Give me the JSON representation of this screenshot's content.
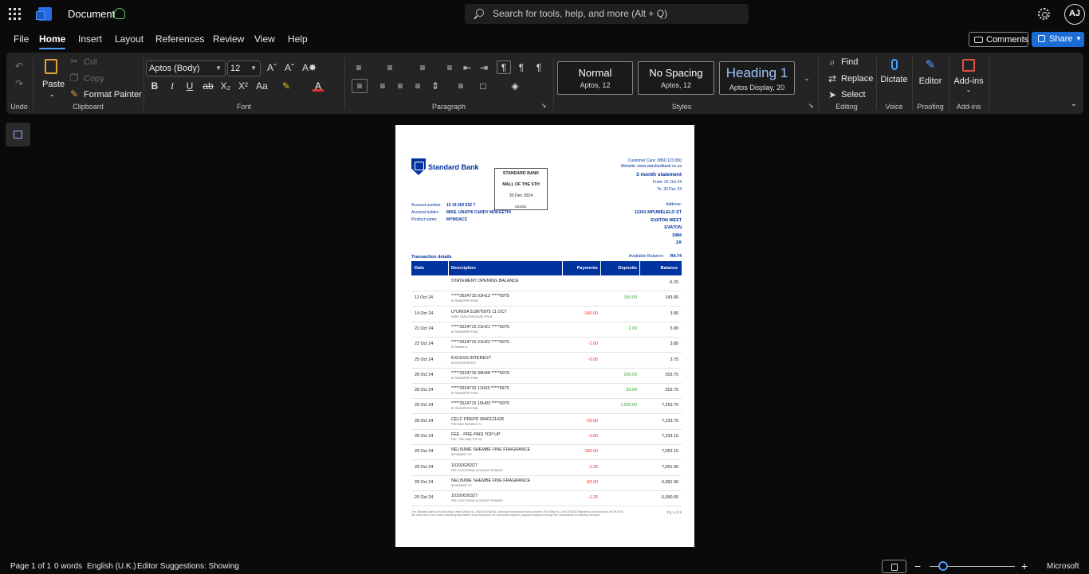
{
  "app": {
    "title": "Document",
    "search_placeholder": "Search for tools, help, and more (Alt + Q)",
    "user_initials": "AJ"
  },
  "menu": [
    "File",
    "Home",
    "Insert",
    "Layout",
    "References",
    "Review",
    "View",
    "Help"
  ],
  "actions": {
    "comments": "Comments",
    "share": "Share"
  },
  "ribbon": {
    "undo_label": "Undo",
    "clipboard": {
      "paste": "Paste",
      "cut": "Cut",
      "copy": "Copy",
      "format_painter": "Format Painter",
      "label": "Clipboard"
    },
    "font": {
      "name": "Aptos (Body)",
      "size": "12",
      "label": "Font"
    },
    "paragraph": {
      "label": "Paragraph"
    },
    "styles": {
      "items": [
        {
          "name": "Normal",
          "sub": "Aptos, 12"
        },
        {
          "name": "No Spacing",
          "sub": "Aptos, 12"
        },
        {
          "name": "Heading 1",
          "sub": "Aptos Display, 20"
        }
      ],
      "label": "Styles"
    },
    "editing": {
      "find": "Find",
      "replace": "Replace",
      "select": "Select",
      "label": "Editing"
    },
    "voice": {
      "dictate": "Dictate",
      "label": "Voice"
    },
    "proofing": {
      "editor": "Editor",
      "label": "Proofing"
    },
    "addins": {
      "addins": "Add-ins",
      "label": "Add-ins"
    }
  },
  "statement": {
    "bank_name": "Standard Bank",
    "stamp": [
      "STANDARD BANK",
      "MALL OF THE STH",
      "30 Dec 2024",
      "051001"
    ],
    "customer_care": "Customer Care: 0860 123 000",
    "website": "Website: www.standardbank.co.za",
    "title": "3 month statement",
    "from": "From: 01 Oct 24",
    "to": "To: 30 Dec 24",
    "account_number_label": "Account number:",
    "account_number": "10 19 262 632 7",
    "account_holder_label": "Account holder:",
    "account_holder": "MISS. UNATHI CANDY MOKGETHI",
    "product_label": "Product name:",
    "product": "MYMOACC",
    "address_label": "Address:",
    "address": [
      "11341 MPUMELELO ST",
      "EVATON WEST",
      "EVATON",
      "1984",
      "ZA"
    ],
    "transaction_details": "Transaction details",
    "available_balance_label": "Available Balance:",
    "available_balance": "R4.74",
    "columns": [
      "Date",
      "Description",
      "Payments",
      "Deposits",
      "Balance"
    ],
    "rows": [
      {
        "date": "",
        "desc": "STATEMENT OPENING BALANCE",
        "sub": "",
        "payment": "",
        "deposit": "",
        "balance": "-6.20"
      },
      {
        "date": "11 Oct 24",
        "desc": "*****2624715 02H12 *****6975",
        "sub": "IB TRANSFER FROM",
        "payment": "",
        "deposit": "150.00",
        "balance": "143.80"
      },
      {
        "date": "14 Oct 24",
        "desc": "U*UNISA 5196*6975 11 OCT",
        "sub": "DEBIT CARD PURCHASE FROM",
        "payment": "-140.00",
        "deposit": "",
        "balance": "3.80"
      },
      {
        "date": "22 Oct 24",
        "desc": "*****2624715 21H21 *****6975",
        "sub": "IB TRANSFER FROM",
        "payment": "",
        "deposit": "2.00",
        "balance": "5.80"
      },
      {
        "date": "22 Oct 24",
        "desc": "*****2624715 21H22 *****6975",
        "sub": "IB Transfer to",
        "payment": "-2.00",
        "deposit": "",
        "balance": "3.80"
      },
      {
        "date": "25 Oct 24",
        "desc": "EXCESS INTEREST",
        "sub": "EXCESS INTEREST",
        "payment": "-0.05",
        "deposit": "",
        "balance": "3.75"
      },
      {
        "date": "28 Oct 24",
        "desc": "*****2624715 09H48 *****6975",
        "sub": "IB TRANSFER FROM",
        "payment": "",
        "deposit": "200.00",
        "balance": "203.75"
      },
      {
        "date": "28 Oct 24",
        "desc": "*****2624715 11H33 *****6975",
        "sub": "IB TRANSFER FROM",
        "payment": "",
        "deposit": "50.00",
        "balance": "253.75"
      },
      {
        "date": "28 Oct 24",
        "desc": "*****2624715 15H03 *****6975",
        "sub": "IB TRANSFER FROM",
        "payment": "",
        "deposit": "7,000.00",
        "balance": "7,253.75"
      },
      {
        "date": "28 Oct 24",
        "desc": "CELC PREPD 0840121428",
        "sub": "PRE-PAID PAYMENT TO",
        "payment": "-20.00",
        "deposit": "",
        "balance": "7,233.75"
      },
      {
        "date": "28 Oct 24",
        "desc": "FEE - PRE-PAID TOP UP",
        "sub": "FEE - PRE-PAID TOP UP",
        "payment": "-0.60",
        "deposit": "",
        "balance": "7,233.15"
      },
      {
        "date": "29 Oct 24",
        "desc": "NELISIWE SHEMBE FINE FRAGRANCE",
        "sub": "IB PAYMENT TO",
        "payment": "-180.00",
        "deposit": "",
        "balance": "7,053.15"
      },
      {
        "date": "29 Oct 24",
        "desc": "10192626327",
        "sub": "FEE: ELECTRONIC ACCOUNT PAYMENT",
        "payment": "-1.25",
        "deposit": "",
        "balance": "7,051.90"
      },
      {
        "date": "29 Oct 24",
        "desc": "NELISIWE SHEMBE FINE FRAGRANCE",
        "sub": "IB PAYMENT TO",
        "payment": "-60.00",
        "deposit": "",
        "balance": "6,991.90"
      },
      {
        "date": "29 Oct 24",
        "desc": "10192626327",
        "sub": "FEE: ELECTRONIC ACCOUNT PAYMENT",
        "payment": "-1.25",
        "deposit": "",
        "balance": "6,990.65"
      }
    ],
    "footer_line1": "The Standard Bank of South Africa Limited (Reg. No. 1962/000738/06). Authorised financial services provider. FAIS Reg No. 2/06/70/2020 Registered credit provider (NCRCP15).",
    "footer_line2": "We subscribe to the Code of Banking Association South Africa and, for unresolved disputes, support resolution through the Ombudsman for Banking Services.",
    "page_num": "Pg 1 of 8"
  },
  "status": {
    "page": "Page 1 of 1",
    "words": "0 words",
    "language": "English (U.K.)",
    "suggestions": "Editor Suggestions: Showing",
    "brand": "Microsoft"
  }
}
